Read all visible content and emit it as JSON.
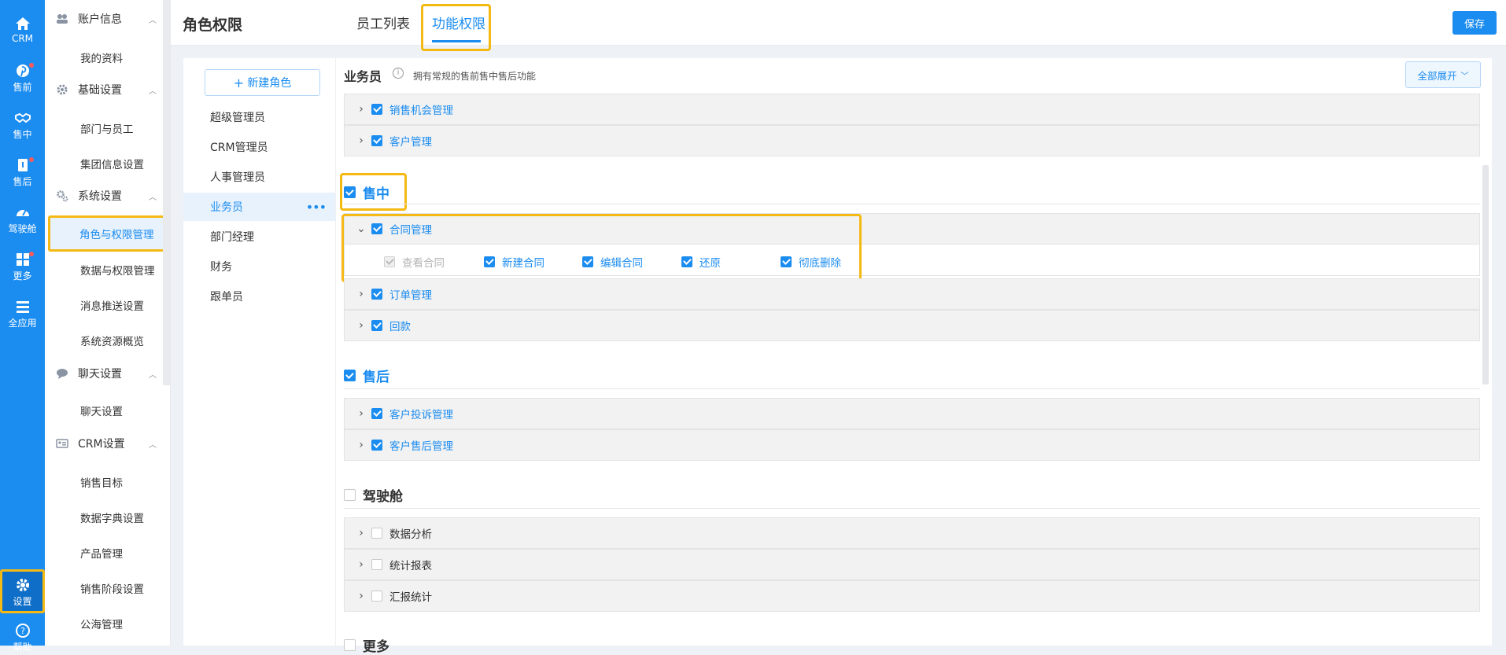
{
  "rail": {
    "items": [
      {
        "label": "CRM",
        "icon": "home-icon",
        "dot": false
      },
      {
        "label": "售前",
        "icon": "pinterest-icon",
        "dot": true
      },
      {
        "label": "售中",
        "icon": "handshake-icon",
        "dot": false
      },
      {
        "label": "售后",
        "icon": "tag-icon",
        "dot": true
      },
      {
        "label": "驾驶舱",
        "icon": "dashboard-icon",
        "dot": false
      },
      {
        "label": "更多",
        "icon": "grid-icon",
        "dot": true
      },
      {
        "label": "全应用",
        "icon": "menu-icon",
        "dot": false
      }
    ],
    "settings": "设置",
    "help": "帮助"
  },
  "sidebar": {
    "groups": [
      {
        "title": "账户信息",
        "icon": "users-icon",
        "items": [
          "我的资料"
        ]
      },
      {
        "title": "基础设置",
        "icon": "gear-icon",
        "items": [
          "部门与员工",
          "集团信息设置"
        ]
      },
      {
        "title": "系统设置",
        "icon": "gears-icon",
        "items": [
          "角色与权限管理",
          "数据与权限管理",
          "消息推送设置",
          "系统资源概览"
        ]
      },
      {
        "title": "聊天设置",
        "icon": "chat-icon",
        "items": [
          "聊天设置"
        ]
      },
      {
        "title": "CRM设置",
        "icon": "idcard-icon",
        "items": [
          "销售目标",
          "数据字典设置",
          "产品管理",
          "销售阶段设置",
          "公海管理"
        ]
      }
    ],
    "active": "角色与权限管理"
  },
  "header": {
    "title": "角色权限",
    "tabs": [
      "员工列表",
      "功能权限"
    ],
    "active_tab": "功能权限",
    "save": "保存"
  },
  "roles": {
    "new_role": "新建角色",
    "items": [
      "超级管理员",
      "CRM管理员",
      "人事管理员",
      "业务员",
      "部门经理",
      "财务",
      "跟单员"
    ],
    "active": "业务员"
  },
  "main": {
    "title": "业务员",
    "desc": "拥有常规的售前售中售后功能",
    "expand_all": "全部展开",
    "top_rows": [
      {
        "label": "销售机会管理",
        "checked": true
      },
      {
        "label": "客户管理",
        "checked": true
      }
    ],
    "sections": [
      {
        "title": "售中",
        "checked": true,
        "rows": [
          {
            "label": "合同管理",
            "checked": true,
            "expanded": true,
            "perms": [
              {
                "label": "查看合同",
                "checked": true,
                "disabled": true
              },
              {
                "label": "新建合同",
                "checked": true,
                "disabled": false
              },
              {
                "label": "编辑合同",
                "checked": true,
                "disabled": false
              },
              {
                "label": "还原",
                "checked": true,
                "disabled": false
              },
              {
                "label": "彻底删除",
                "checked": true,
                "disabled": false
              }
            ]
          },
          {
            "label": "订单管理",
            "checked": true
          },
          {
            "label": "回款",
            "checked": true
          }
        ]
      },
      {
        "title": "售后",
        "checked": true,
        "rows": [
          {
            "label": "客户投诉管理",
            "checked": true
          },
          {
            "label": "客户售后管理",
            "checked": true
          }
        ]
      },
      {
        "title": "驾驶舱",
        "checked": false,
        "rows": [
          {
            "label": "数据分析",
            "checked": false
          },
          {
            "label": "统计报表",
            "checked": false
          },
          {
            "label": "汇报统计",
            "checked": false
          }
        ]
      }
    ],
    "next_section": "更多"
  },
  "colors": {
    "primary": "#1b8cf0",
    "highlight": "#f5b914"
  }
}
